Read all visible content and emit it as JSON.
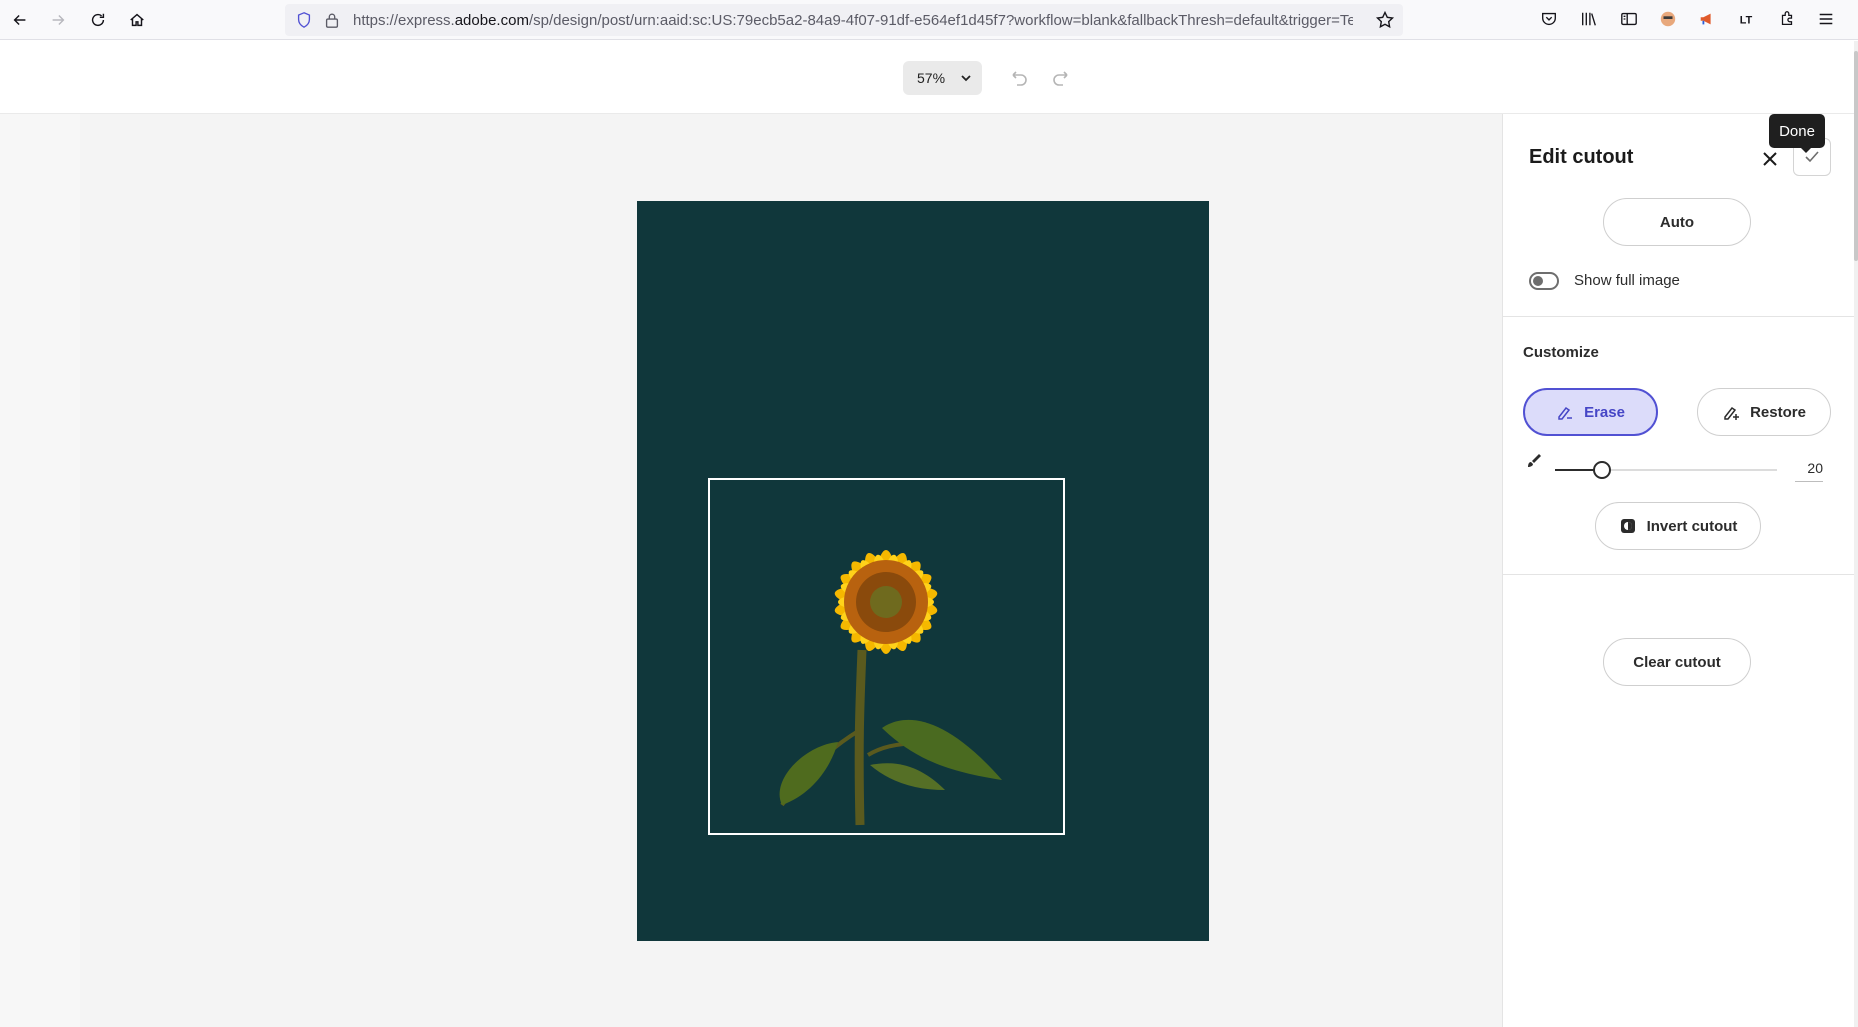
{
  "browser": {
    "url_prefix": "https://express.",
    "url_domain": "adobe.com",
    "url_rest": "/sp/design/post/urn:aaid:sc:US:79ecb5a2-84a9-4f07-91df-e564ef1d45f7?workflow=blank&fallbackThresh=default&trigger=Ter"
  },
  "toolbar": {
    "zoom_value": "57%"
  },
  "canvas": {
    "artboard_color": "#10373b",
    "image_subject": "sunflower"
  },
  "panel": {
    "title": "Edit cutout",
    "tooltip": "Done",
    "auto_label": "Auto",
    "show_full_image_label": "Show full image",
    "show_full_image_on": false,
    "customize_title": "Customize",
    "erase_label": "Erase",
    "restore_label": "Restore",
    "brush_size": "20",
    "invert_label": "Invert cutout",
    "clear_label": "Clear cutout"
  },
  "colors": {
    "accent": "#5151d3",
    "accent_bg": "#dcdcfa"
  }
}
